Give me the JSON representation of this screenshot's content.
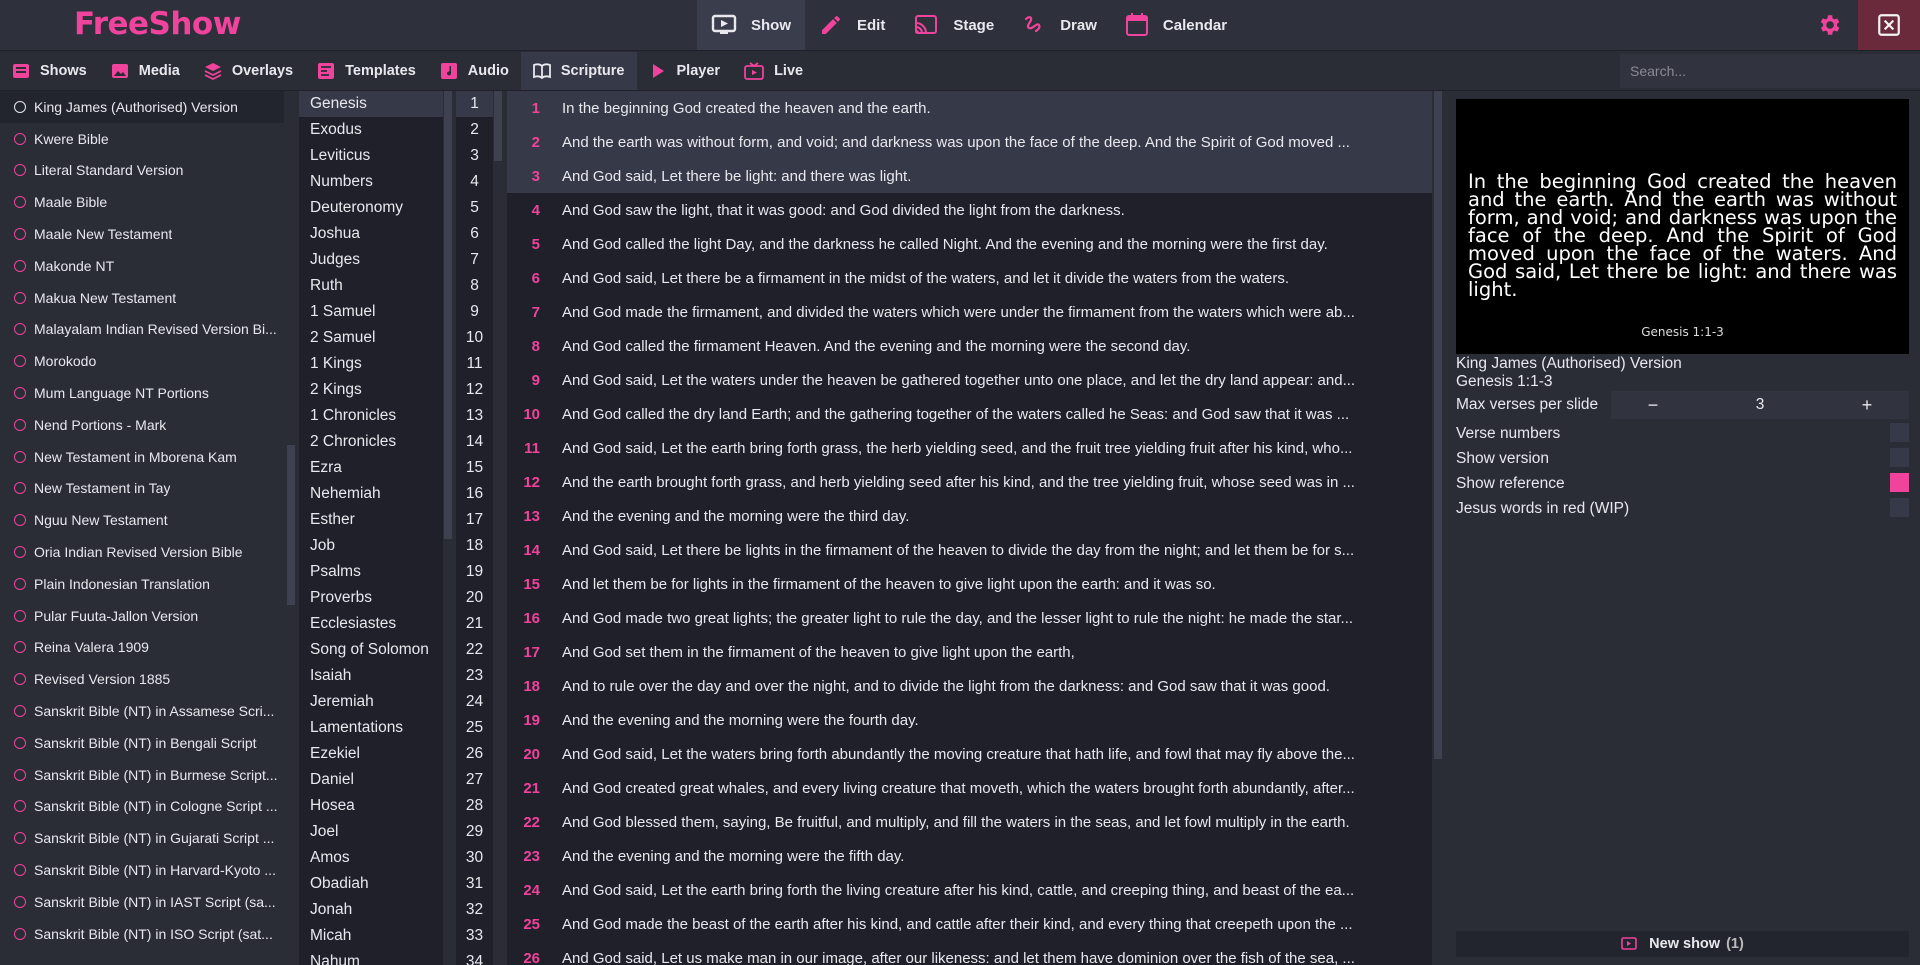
{
  "app": {
    "name": "FreeShow"
  },
  "topnav": [
    {
      "label": "Show",
      "icon": "show-icon",
      "active": true
    },
    {
      "label": "Edit",
      "icon": "edit-icon"
    },
    {
      "label": "Stage",
      "icon": "stage-icon"
    },
    {
      "label": "Draw",
      "icon": "draw-icon"
    },
    {
      "label": "Calendar",
      "icon": "calendar-icon"
    }
  ],
  "tabs": [
    {
      "label": "Shows",
      "icon": "shows-icon"
    },
    {
      "label": "Media",
      "icon": "media-icon"
    },
    {
      "label": "Overlays",
      "icon": "overlays-icon"
    },
    {
      "label": "Templates",
      "icon": "templates-icon"
    },
    {
      "label": "Audio",
      "icon": "audio-icon"
    },
    {
      "label": "Scripture",
      "icon": "scripture-icon",
      "active": true
    },
    {
      "label": "Player",
      "icon": "player-icon"
    },
    {
      "label": "Live",
      "icon": "live-icon"
    }
  ],
  "search": {
    "placeholder": "Search..."
  },
  "versions": [
    "King James (Authorised) Version",
    "Kwere Bible",
    "Literal Standard Version",
    "Maale Bible",
    "Maale New Testament",
    "Makonde NT",
    "Makua New Testament",
    "Malayalam Indian Revised Version Bi...",
    "Morokodo",
    "Mum Language NT Portions",
    "Nend Portions - Mark",
    "New Testament in Mborena Kam",
    "New Testament in Tay",
    "Nguu New Testament",
    "Oria Indian Revised Version Bible",
    "Plain Indonesian Translation",
    "Pular Fuuta-Jallon Version",
    "Reina Valera 1909",
    "Revised Version 1885",
    "Sanskrit Bible (NT) in Assamese Scri...",
    "Sanskrit Bible (NT) in Bengali Script",
    "Sanskrit Bible (NT) in Burmese Script...",
    "Sanskrit Bible (NT) in Cologne Script ...",
    "Sanskrit Bible (NT) in Gujarati Script ...",
    "Sanskrit Bible (NT) in Harvard-Kyoto ...",
    "Sanskrit Bible (NT) in IAST Script (sa...",
    "Sanskrit Bible (NT) in ISO Script (sat..."
  ],
  "books": [
    "Genesis",
    "Exodus",
    "Leviticus",
    "Numbers",
    "Deuteronomy",
    "Joshua",
    "Judges",
    "Ruth",
    "1 Samuel",
    "2 Samuel",
    "1 Kings",
    "2 Kings",
    "1 Chronicles",
    "2 Chronicles",
    "Ezra",
    "Nehemiah",
    "Esther",
    "Job",
    "Psalms",
    "Proverbs",
    "Ecclesiastes",
    "Song of Solomon",
    "Isaiah",
    "Jeremiah",
    "Lamentations",
    "Ezekiel",
    "Daniel",
    "Hosea",
    "Joel",
    "Amos",
    "Obadiah",
    "Jonah",
    "Micah",
    "Nahum"
  ],
  "chapters": [
    "1",
    "2",
    "3",
    "4",
    "5",
    "6",
    "7",
    "8",
    "9",
    "10",
    "11",
    "12",
    "13",
    "14",
    "15",
    "16",
    "17",
    "18",
    "19",
    "20",
    "21",
    "22",
    "23",
    "24",
    "25",
    "26",
    "27",
    "28",
    "29",
    "30",
    "31",
    "32",
    "33",
    "34"
  ],
  "verses": [
    {
      "n": "1",
      "t": "In the beginning God created the heaven and the earth."
    },
    {
      "n": "2",
      "t": "And the earth was without form, and void; and darkness was upon the face of the deep. And the Spirit of God moved ..."
    },
    {
      "n": "3",
      "t": "And God said, Let there be light: and there was light."
    },
    {
      "n": "4",
      "t": "And God saw the light, that it was good: and God divided the light from the darkness."
    },
    {
      "n": "5",
      "t": "And God called the light Day, and the darkness he called Night. And the evening and the morning were the first day."
    },
    {
      "n": "6",
      "t": "And God said, Let there be a firmament in the midst of the waters, and let it divide the waters from the waters."
    },
    {
      "n": "7",
      "t": "And God made the firmament, and divided the waters which were under the firmament from the waters which were ab..."
    },
    {
      "n": "8",
      "t": "And God called the firmament Heaven. And the evening and the morning were the second day."
    },
    {
      "n": "9",
      "t": "And God said, Let the waters under the heaven be gathered together unto one place, and let the dry land appear: and..."
    },
    {
      "n": "10",
      "t": "And God called the dry land Earth; and the gathering together of the waters called he Seas: and God saw that it was ..."
    },
    {
      "n": "11",
      "t": "And God said, Let the earth bring forth grass, the herb yielding seed, and the fruit tree yielding fruit after his kind, who..."
    },
    {
      "n": "12",
      "t": "And the earth brought forth grass, and herb yielding seed after his kind, and the tree yielding fruit, whose seed was in ..."
    },
    {
      "n": "13",
      "t": "And the evening and the morning were the third day."
    },
    {
      "n": "14",
      "t": "And God said, Let there be lights in the firmament of the heaven to divide the day from the night; and let them be for s..."
    },
    {
      "n": "15",
      "t": "And let them be for lights in the firmament of the heaven to give light upon the earth: and it was so."
    },
    {
      "n": "16",
      "t": "And God made two great lights; the greater light to rule the day, and the lesser light to rule the night: he made the star..."
    },
    {
      "n": "17",
      "t": "And God set them in the firmament of the heaven to give light upon the earth,"
    },
    {
      "n": "18",
      "t": "And to rule over the day and over the night, and to divide the light from the darkness: and God saw that it was good."
    },
    {
      "n": "19",
      "t": "And the evening and the morning were the fourth day."
    },
    {
      "n": "20",
      "t": "And God said, Let the waters bring forth abundantly the moving creature that hath life, and fowl that may fly above the..."
    },
    {
      "n": "21",
      "t": "And God created great whales, and every living creature that moveth, which the waters brought forth abundantly, after..."
    },
    {
      "n": "22",
      "t": "And God blessed them, saying, Be fruitful, and multiply, and fill the waters in the seas, and let fowl multiply in the earth."
    },
    {
      "n": "23",
      "t": "And the evening and the morning were the fifth day."
    },
    {
      "n": "24",
      "t": "And God said, Let the earth bring forth the living creature after his kind, cattle, and creeping thing, and beast of the ea..."
    },
    {
      "n": "25",
      "t": "And God made the beast of the earth after his kind, and cattle after their kind, and every thing that creepeth upon the ..."
    },
    {
      "n": "26",
      "t": "And God said, Let us make man in our image, after our likeness: and let them have dominion over the fish of the sea, ..."
    }
  ],
  "preview": {
    "text": "In the beginning God created the heaven and the earth. And the earth was without form, and void; and darkness was upon the face of the deep. And the Spirit of God moved upon the face of the waters. And God said, Let there be light: and there was light.",
    "reference": "Genesis 1:1-3"
  },
  "info": {
    "version": "King James (Authorised) Version",
    "reference": "Genesis 1:1-3"
  },
  "settings": {
    "max_label": "Max verses per slide",
    "max_value": "3",
    "minus": "−",
    "plus": "+",
    "options": [
      {
        "label": "Verse numbers",
        "checked": false
      },
      {
        "label": "Show version",
        "checked": false
      },
      {
        "label": "Show reference",
        "checked": true
      },
      {
        "label": "Jesus words in red (WIP)",
        "checked": false
      }
    ]
  },
  "footer": {
    "label": "New show",
    "count": "(1)"
  },
  "colors": {
    "accent": "#f0439c",
    "bg": "#2a2c36",
    "panel": "#1f2029",
    "selected": "#363947"
  }
}
